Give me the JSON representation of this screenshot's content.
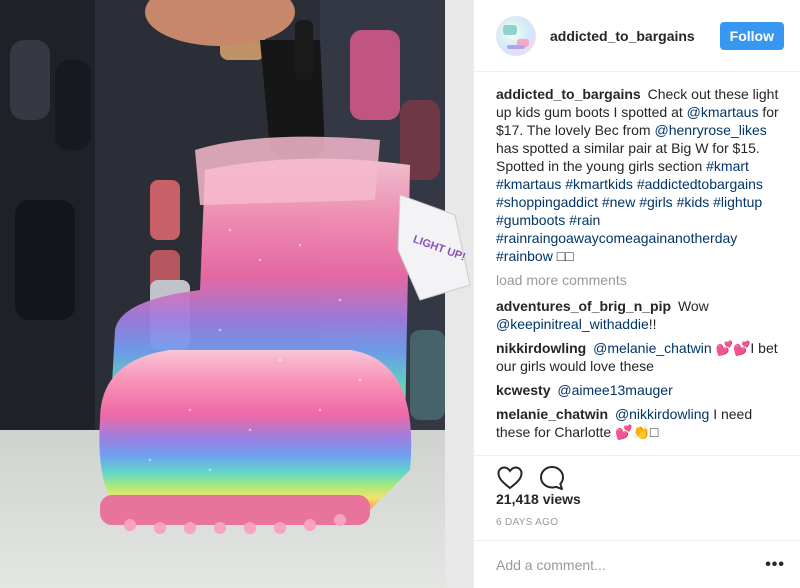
{
  "header": {
    "username": "addicted_to_bargains",
    "follow_label": "Follow"
  },
  "caption": {
    "author": "addicted_to_bargains",
    "text_1": "Check out these light up kids gum boots I spotted at",
    "mention_1": "@kmartaus",
    "text_2": "for $17. The lovely Bec from",
    "mention_2": "@henryrose_likes",
    "text_3": "has spotted a similar pair at Big W for $15. Spotted in the young girls section",
    "hashtags": "#kmart #kmartaus #kmartkids #addictedtobargains #shoppingaddict #new #girls #kids #lightup #gumboots #rain #rainraingoawaycomeagainanotherday #rainbow",
    "emoji": "□□"
  },
  "load_more_label": "load more comments",
  "comments": [
    {
      "author": "adventures_of_brig_n_pip",
      "text_before": "Wow",
      "mention": "@keepinitreal_withaddie",
      "text_after": "!!"
    },
    {
      "author": "nikkirdowling",
      "text_before": "",
      "mention": "@melanie_chatwin",
      "text_after": "💕💕I bet our girls would love these"
    },
    {
      "author": "kcwesty",
      "text_before": "",
      "mention": "@aimee13mauger",
      "text_after": ""
    },
    {
      "author": "melanie_chatwin",
      "text_before": "",
      "mention": "@nikkirdowling",
      "text_after": "I need these for Charlotte 💕👏□"
    }
  ],
  "stats": {
    "views": "21,418 views",
    "date": "6 DAYS AGO"
  },
  "add_comment": {
    "placeholder": "Add a comment...",
    "more_label": "•••"
  },
  "colors": {
    "follow": "#3897f0",
    "link": "#003569",
    "muted": "#999999"
  },
  "photo": {
    "tag_text": "LIGHT UP!"
  }
}
